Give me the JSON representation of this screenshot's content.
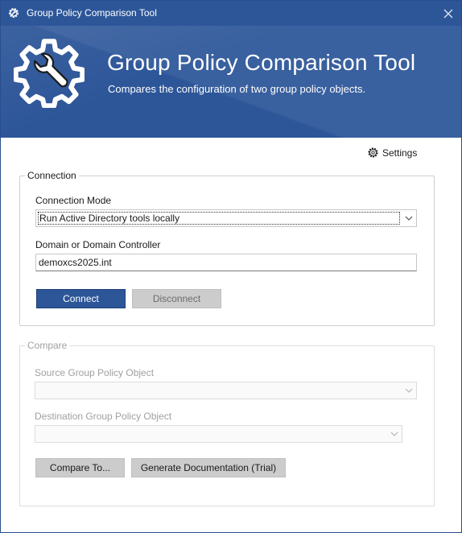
{
  "window": {
    "title": "Group Policy Comparison Tool",
    "close_glyph": "✕"
  },
  "banner": {
    "title": "Group Policy Comparison Tool",
    "subtitle": "Compares the configuration of two group policy objects.",
    "logo_icon": "gear-wrench-icon"
  },
  "settings": {
    "label": "Settings",
    "icon": "gear-icon"
  },
  "connection": {
    "legend": "Connection",
    "mode_label": "Connection Mode",
    "mode_value": "Run Active Directory tools locally",
    "domain_label": "Domain or Domain Controller",
    "domain_value": "demoxcs2025.int",
    "connect_label": "Connect",
    "disconnect_label": "Disconnect"
  },
  "compare": {
    "legend": "Compare",
    "source_label": "Source Group Policy Object",
    "source_value": "",
    "destination_label": "Destination Group Policy Object",
    "destination_value": "",
    "compare_to_label": "Compare To...",
    "generate_label": "Generate Documentation (Trial)"
  },
  "colors": {
    "accent": "#2d5699",
    "button_gray": "#cccccc",
    "disabled_text": "#a0a0a0"
  }
}
